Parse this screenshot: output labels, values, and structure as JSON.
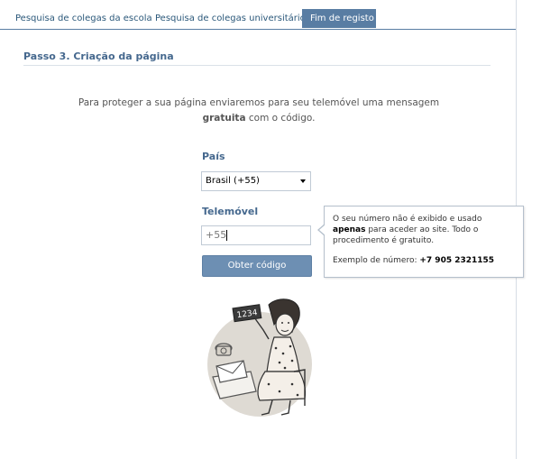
{
  "tabs": [
    {
      "label": "Pesquisa de colegas da escola",
      "active": false
    },
    {
      "label": "Pesquisa de colegas universitários",
      "active": false
    },
    {
      "label": "Fim de registo",
      "active": true
    }
  ],
  "step": {
    "title": "Passo 3. Criação da página"
  },
  "intro": {
    "text_before": "Para proteger a sua página enviaremos para seu telemóvel uma mensagem",
    "bold": "gratuita",
    "text_after": "com o código."
  },
  "form": {
    "country_label": "País",
    "country_value": "Brasil (+55)",
    "phone_label": "Telemóvel",
    "phone_value": "+55",
    "submit_label": "Obter código"
  },
  "tooltip": {
    "line1_before": "O seu número não é exibido e usado",
    "line1_bold": "apenas",
    "line1_after": "para aceder ao site. Todo o procedimento é gratuito.",
    "example_label": "Exemplo de número:",
    "example_number": "+7 905 2321155"
  },
  "illustration": {
    "sign_text": "1234"
  },
  "colors": {
    "accent": "#597da3",
    "button": "#6d8fb3",
    "heading": "#45688e"
  }
}
